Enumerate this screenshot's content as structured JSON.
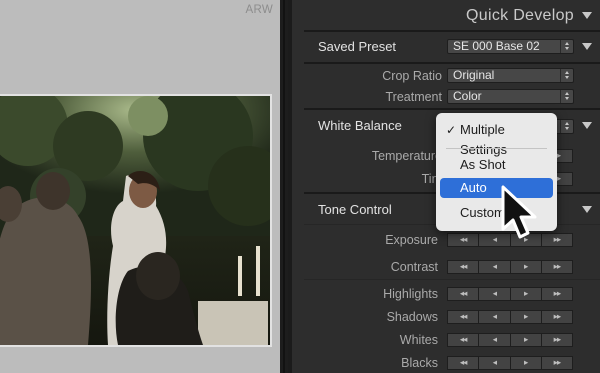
{
  "viewer": {
    "file_type": "ARW",
    "photo_description_icon": "wedding-photo-image"
  },
  "panel": {
    "title": "Quick Develop",
    "saved_preset": {
      "label": "Saved Preset",
      "value": "SE 000 Base 02"
    },
    "crop_ratio": {
      "label": "Crop Ratio",
      "value": "Original"
    },
    "treatment": {
      "label": "Treatment",
      "value": "Color"
    },
    "white_balance": {
      "label": "White Balance",
      "temperature_label": "Temperature",
      "tint_label": "Tint"
    },
    "tone_control": {
      "label": "Tone Control",
      "rows": [
        {
          "label": "Exposure"
        },
        {
          "label": "Contrast"
        },
        {
          "label": "Highlights"
        },
        {
          "label": "Shadows"
        },
        {
          "label": "Whites"
        },
        {
          "label": "Blacks"
        }
      ],
      "buttons": [
        "◂◂",
        "◂",
        "▸",
        "▸▸"
      ]
    }
  },
  "menu": {
    "items": [
      {
        "label": "Multiple Settings",
        "checked": true
      },
      {
        "label": "As Shot"
      },
      {
        "label": "Auto",
        "selected": true
      },
      {
        "label": "Custom"
      }
    ],
    "check_glyph": "✓",
    "selected_color": "#2e6fd8"
  }
}
